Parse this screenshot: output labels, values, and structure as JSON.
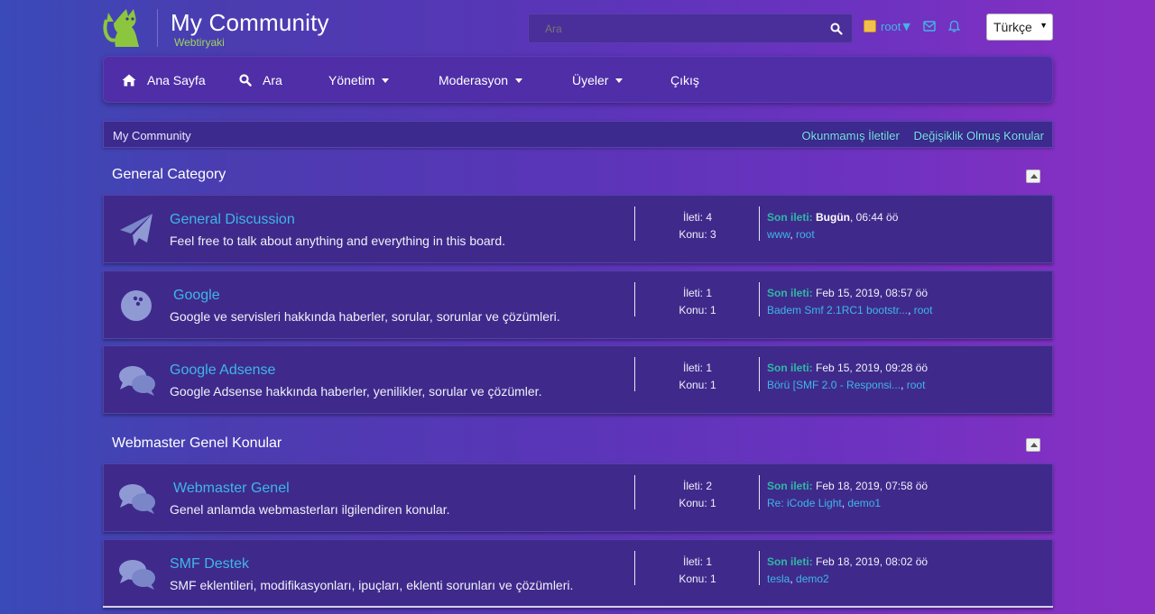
{
  "header": {
    "site_title": "My Community",
    "site_subtitle": "Webtiryaki",
    "search_placeholder": "Ara",
    "user_name": "root",
    "user_caret": "▼",
    "language": "Türkçe",
    "language_arrow": "▼"
  },
  "nav": {
    "items": [
      {
        "label": "Ana Sayfa"
      },
      {
        "label": "Ara"
      },
      {
        "label": "Yönetim"
      },
      {
        "label": "Moderasyon"
      },
      {
        "label": "Üyeler"
      },
      {
        "label": "Çıkış"
      }
    ]
  },
  "breadcrumb": {
    "current": "My Community",
    "unread_link": "Okunmamış İletiler",
    "updated_link": "Değişiklik Olmuş Konular"
  },
  "categories": [
    {
      "title": "General Category",
      "boards": [
        {
          "icon": "paper-plane-icon",
          "name": "General Discussion",
          "desc": "Feel free to talk about anything and everything in this board.",
          "posts": "İleti: 4",
          "topics": "Konu: 3",
          "last_label": "Son ileti:",
          "last_date_bold": "Bugün",
          "last_date_rest": ", 06:44 öö",
          "last_topic": "www",
          "sep": ", ",
          "last_user": "root"
        },
        {
          "icon": "bowling-ball-icon",
          "name": "Google",
          "desc": "Google ve servisleri hakkında haberler, sorular, sorunlar ve çözümleri.",
          "posts": "İleti: 1",
          "topics": "Konu: 1",
          "last_label": "Son ileti:",
          "last_date_bold": "",
          "last_date_rest": " Feb 15, 2019, 08:57 öö",
          "last_topic": "Badem Smf 2.1RC1 bootstr...",
          "sep": ", ",
          "last_user": "root"
        },
        {
          "icon": "comments-icon",
          "name": "Google Adsense",
          "desc": "Google Adsense hakkında haberler, yenilikler, sorular ve çözümler.",
          "posts": "İleti: 1",
          "topics": "Konu: 1",
          "last_label": "Son ileti:",
          "last_date_bold": "",
          "last_date_rest": " Feb 15, 2019, 09:28 öö",
          "last_topic": "Börü [SMF 2.0 - Responsi...",
          "sep": ", ",
          "last_user": "root"
        }
      ]
    },
    {
      "title": "Webmaster Genel Konular",
      "boards": [
        {
          "icon": "comments-icon",
          "name": "Webmaster Genel",
          "desc": "Genel anlamda webmasterları ilgilendiren konular.",
          "posts": "İleti: 2",
          "topics": "Konu: 1",
          "last_label": "Son ileti:",
          "last_date_bold": "",
          "last_date_rest": " Feb 18, 2019, 07:58 öö",
          "last_topic": "Re: iCode Light",
          "sep": ", ",
          "last_user": "demo1"
        },
        {
          "icon": "comments-icon",
          "name": "SMF Destek",
          "desc": "SMF eklentileri, modifikasyonları, ipuçları, eklenti sorunları ve çözümleri.",
          "posts": "İleti: 1",
          "topics": "Konu: 1",
          "last_label": "Son ileti:",
          "last_date_bold": "",
          "last_date_rest": " Feb 18, 2019, 08:02 öö",
          "last_topic": "tesla",
          "sep": ", ",
          "last_user": "demo2"
        }
      ]
    }
  ],
  "colors": {
    "accent_link": "#3fb6e6",
    "last_post_label": "#2fb8a4",
    "logo_green": "#8cc63f"
  }
}
